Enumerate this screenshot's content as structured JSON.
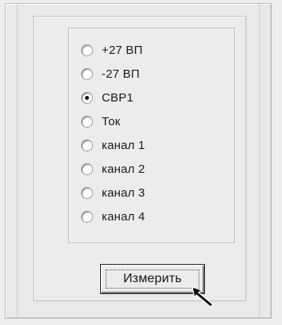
{
  "radio_group": {
    "options": [
      {
        "label": "+27 ВП",
        "selected": false
      },
      {
        "label": "-27 ВП",
        "selected": false
      },
      {
        "label": "СВР1",
        "selected": true
      },
      {
        "label": "Ток",
        "selected": false
      },
      {
        "label": "канал 1",
        "selected": false
      },
      {
        "label": "канал 2",
        "selected": false
      },
      {
        "label": "канал 3",
        "selected": false
      },
      {
        "label": "канал 4",
        "selected": false
      }
    ]
  },
  "button": {
    "measure_label": "Измерить"
  }
}
